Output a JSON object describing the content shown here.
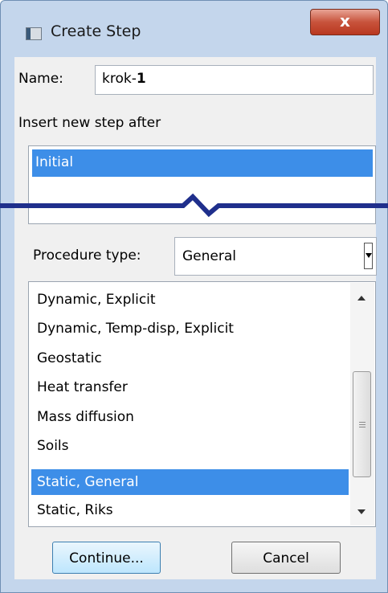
{
  "window": {
    "title": "Create Step",
    "close_label": "x"
  },
  "name_field": {
    "label": "Name:",
    "value_prefix": "krok-",
    "value_suffix": "1"
  },
  "insert_after": {
    "label": "Insert new step after",
    "items": [
      "Initial"
    ],
    "selected": "Initial"
  },
  "procedure": {
    "label": "Procedure type:",
    "selected": "General",
    "items": [
      "Dynamic, Explicit",
      "Dynamic, Temp-disp, Explicit",
      "Geostatic",
      "Heat transfer",
      "Mass diffusion",
      "Soils",
      "Static, General",
      "Static, Riks"
    ],
    "selected_item": "Static, General"
  },
  "buttons": {
    "continue": "Continue...",
    "cancel": "Cancel"
  },
  "colors": {
    "selection": "#3d8ee8",
    "break_line": "#1f2f8c"
  }
}
